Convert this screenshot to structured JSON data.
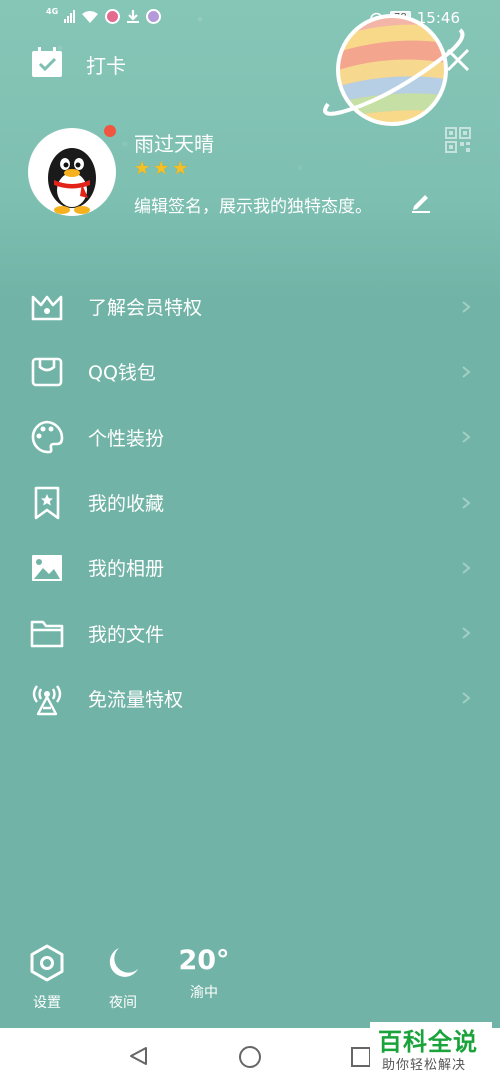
{
  "status_bar": {
    "network": "4G",
    "time": "15:46",
    "battery": "78"
  },
  "header": {
    "checkin_label": "打卡"
  },
  "profile": {
    "nickname": "雨过天晴",
    "star_count": 3,
    "signature": "编辑签名，展示我的独特态度。"
  },
  "menu": {
    "items": [
      {
        "label": "了解会员特权",
        "icon": "crown-icon"
      },
      {
        "label": "QQ钱包",
        "icon": "wallet-icon"
      },
      {
        "label": "个性装扮",
        "icon": "palette-icon"
      },
      {
        "label": "我的收藏",
        "icon": "bookmark-star-icon"
      },
      {
        "label": "我的相册",
        "icon": "photo-icon"
      },
      {
        "label": "我的文件",
        "icon": "folder-icon"
      },
      {
        "label": "免流量特权",
        "icon": "signal-tower-icon"
      }
    ]
  },
  "bottom": {
    "settings_label": "设置",
    "night_label": "夜间",
    "weather_temp": "20°",
    "weather_city": "渝中"
  },
  "watermark": {
    "title": "百科全说",
    "subtitle": "助你轻松解决"
  },
  "colors": {
    "background": "#71b4a7",
    "accent_star": "#f5c026",
    "notification": "#f1543f",
    "watermark_green": "#1aa33b"
  }
}
